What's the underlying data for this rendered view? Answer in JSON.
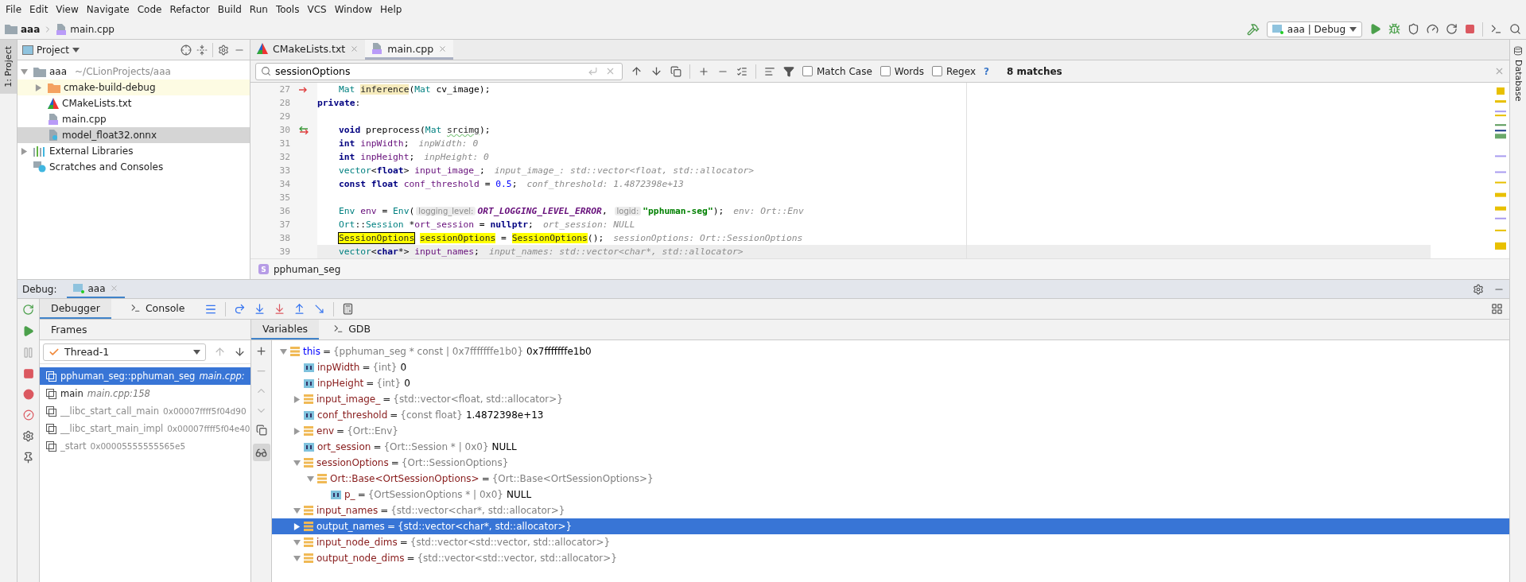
{
  "menu": [
    "File",
    "Edit",
    "View",
    "Navigate",
    "Code",
    "Refactor",
    "Build",
    "Run",
    "Tools",
    "VCS",
    "Window",
    "Help"
  ],
  "breadcrumb": [
    {
      "label": "aaa",
      "kind": "folder"
    },
    {
      "label": "main.cpp",
      "kind": "cpp"
    }
  ],
  "run_config": "aaa | Debug",
  "left_stripe": [
    {
      "label": "1: Project",
      "selected": true
    }
  ],
  "right_stripe": [
    {
      "label": "Database"
    }
  ],
  "project_panel": {
    "title": "Project",
    "tree": [
      {
        "label": "aaa",
        "path": "~/CLionProjects/aaa",
        "kind": "folder",
        "expanded": true,
        "selected": false,
        "highlighted": false,
        "children": [
          {
            "label": "cmake-build-debug",
            "kind": "build_folder",
            "expanded": false,
            "selected": false,
            "highlighted": true
          },
          {
            "label": "CMakeLists.txt",
            "kind": "cmake",
            "selected": false,
            "highlighted": false
          },
          {
            "label": "main.cpp",
            "kind": "cpp",
            "selected": false,
            "highlighted": false
          },
          {
            "label": "model_float32.onnx",
            "kind": "unknown",
            "selected": true,
            "highlighted": false
          }
        ]
      },
      {
        "label": "External Libraries",
        "kind": "libraries",
        "expanded": false,
        "selected": false,
        "highlighted": false
      },
      {
        "label": "Scratches and Consoles",
        "kind": "scratches",
        "selected": false,
        "highlighted": false
      }
    ]
  },
  "editor": {
    "tabs": [
      {
        "label": "CMakeLists.txt",
        "kind": "cmake",
        "selected": false
      },
      {
        "label": "main.cpp",
        "kind": "cpp",
        "selected": true
      }
    ],
    "find": {
      "value": "sessionOptions",
      "options": [
        {
          "label": "Match Case",
          "checked": false
        },
        {
          "label": "Words",
          "checked": false
        },
        {
          "label": "Regex",
          "checked": false
        }
      ],
      "help": "?",
      "matches": "8 matches"
    },
    "lines": [
      {
        "number": "27",
        "gutter": {
          "kind": "override"
        },
        "current": false,
        "indented": true,
        "tokens": [
          {
            "text": "Mat ",
            "kind": "type"
          },
          {
            "text": "inference",
            "kind": "ref"
          },
          {
            "text": "(",
            "kind": "plain"
          },
          {
            "text": "Mat",
            "kind": "type"
          },
          {
            "text": " cv_image);",
            "kind": "plain"
          }
        ]
      },
      {
        "number": "28",
        "current": false,
        "indented": false,
        "tokens": [
          {
            "text": "private",
            "kind": "kw"
          },
          {
            "text": ":",
            "kind": "plain"
          }
        ]
      },
      {
        "number": "29",
        "current": false
      },
      {
        "number": "30",
        "gutter": {
          "kind": "implements"
        },
        "current": false,
        "indented": true,
        "tokens": [
          {
            "text": "void",
            "kind": "kw"
          },
          {
            "text": " preprocess(",
            "kind": "plain"
          },
          {
            "text": "Mat ",
            "kind": "type"
          },
          {
            "text": "srcimg",
            "kind": "typo"
          },
          {
            "text": ");",
            "kind": "plain"
          }
        ]
      },
      {
        "number": "31",
        "current": false,
        "indented": true,
        "tokens": [
          {
            "text": "int ",
            "kind": "kw"
          },
          {
            "text": "inpWidth",
            "kind": "field"
          },
          {
            "text": ";",
            "kind": "plain"
          },
          {
            "text": "inpWidth: 0",
            "kind": "inlay"
          }
        ]
      },
      {
        "number": "32",
        "current": false,
        "indented": true,
        "tokens": [
          {
            "text": "int ",
            "kind": "kw"
          },
          {
            "text": "inpHeight",
            "kind": "field"
          },
          {
            "text": ";",
            "kind": "plain"
          },
          {
            "text": "inpHeight: 0",
            "kind": "inlay"
          }
        ]
      },
      {
        "number": "33",
        "current": false,
        "indented": true,
        "tokens": [
          {
            "text": "vector",
            "kind": "type"
          },
          {
            "text": "<",
            "kind": "plain"
          },
          {
            "text": "float",
            "kind": "kw"
          },
          {
            "text": "> ",
            "kind": "plain"
          },
          {
            "text": "input_image_",
            "kind": "field"
          },
          {
            "text": ";",
            "kind": "plain"
          },
          {
            "text": "input_image_: std::vector<float, std::allocator>",
            "kind": "inlay"
          }
        ]
      },
      {
        "number": "34",
        "current": false,
        "indented": true,
        "tokens": [
          {
            "text": "const ",
            "kind": "kw"
          },
          {
            "text": "float ",
            "kind": "kw"
          },
          {
            "text": "conf_threshold",
            "kind": "field"
          },
          {
            "text": " = ",
            "kind": "plain"
          },
          {
            "text": "0.5",
            "kind": "num"
          },
          {
            "text": ";",
            "kind": "plain"
          },
          {
            "text": "conf_threshold: 1.4872398e+13",
            "kind": "inlay"
          }
        ]
      },
      {
        "number": "35",
        "current": false
      },
      {
        "number": "36",
        "current": false,
        "indented": true,
        "tokens": [
          {
            "text": "Env ",
            "kind": "type"
          },
          {
            "text": "env",
            "kind": "field"
          },
          {
            "text": " = ",
            "kind": "plain"
          },
          {
            "text": "Env",
            "kind": "type"
          },
          {
            "text": "(",
            "kind": "plain"
          },
          {
            "text": "logging_level:",
            "kind": "hint"
          },
          {
            "text": "ORT_LOGGING_LEVEL_ERROR",
            "kind": "enum"
          },
          {
            "text": ", ",
            "kind": "plain"
          },
          {
            "text": "logid:",
            "kind": "hint"
          },
          {
            "text": "\"pphuman-seg\"",
            "kind": "str"
          },
          {
            "text": ");",
            "kind": "plain"
          },
          {
            "text": "env: Ort::Env",
            "kind": "inlay"
          }
        ]
      },
      {
        "number": "37",
        "current": false,
        "indented": true,
        "tokens": [
          {
            "text": "Ort",
            "kind": "type"
          },
          {
            "text": "::",
            "kind": "plain"
          },
          {
            "text": "Session",
            "kind": "type"
          },
          {
            "text": " *",
            "kind": "plain"
          },
          {
            "text": "ort_session",
            "kind": "field"
          },
          {
            "text": " = ",
            "kind": "plain"
          },
          {
            "text": "nullptr",
            "kind": "kw"
          },
          {
            "text": ";",
            "kind": "plain"
          },
          {
            "text": "ort_session: NULL",
            "kind": "inlay"
          }
        ]
      },
      {
        "number": "38",
        "current": false,
        "indented": true,
        "tokens": [
          {
            "text": "SessionOptions",
            "kind": "match_current"
          },
          {
            "text": "sessionOptions",
            "kind": "match"
          },
          {
            "text": " = ",
            "kind": "plain"
          },
          {
            "text": "SessionOptions",
            "kind": "match"
          },
          {
            "text": "();",
            "kind": "plain"
          },
          {
            "text": "sessionOptions: Ort::SessionOptions",
            "kind": "inlay"
          }
        ]
      },
      {
        "number": "39",
        "current": true,
        "indented": true,
        "tokens": [
          {
            "text": "vector",
            "kind": "type"
          },
          {
            "text": "<",
            "kind": "plain"
          },
          {
            "text": "char",
            "kind": "kw"
          },
          {
            "text": "*> ",
            "kind": "plain"
          },
          {
            "text": "input_names",
            "kind": "field"
          },
          {
            "text": ";",
            "kind": "plain"
          },
          {
            "text": "input_names: std::vector<char*, std::allocator>",
            "kind": "inlay"
          }
        ]
      }
    ],
    "context": {
      "icon_letter": "S",
      "label": "pphuman_seg"
    }
  },
  "debug": {
    "title": "Debug:",
    "session": "aaa",
    "tabs": [
      {
        "label": "Debugger",
        "selected": true
      },
      {
        "label": "Console",
        "selected": false
      }
    ],
    "frames": {
      "title": "Frames",
      "thread": "Thread-1",
      "items": [
        {
          "name": "pphuman_seg::pphuman_seg",
          "location": "main.cpp:",
          "selected": true,
          "dimmed": false
        },
        {
          "name": "main",
          "location": "main.cpp:158",
          "selected": false,
          "dimmed": false
        },
        {
          "name": "__libc_start_call_main",
          "location": "0x00007ffff5f04d90",
          "selected": false,
          "dimmed": true
        },
        {
          "name": "__libc_start_main_impl",
          "location": "0x00007ffff5f04e40",
          "selected": false,
          "dimmed": true
        },
        {
          "name": "_start",
          "location": "0x00005555555565e5",
          "selected": false,
          "dimmed": true
        }
      ]
    },
    "variable_tabs": [
      {
        "label": "Variables",
        "selected": true
      },
      {
        "label": "GDB",
        "selected": false
      }
    ],
    "variables": [
      {
        "name": "this",
        "eq": "=",
        "kind": "this",
        "expanded": true,
        "selected": false,
        "type": "{pphuman_seg * const | 0x7fffffffe1b0}",
        "value": "0x7fffffffe1b0",
        "children": [
          {
            "name": "inpWidth",
            "eq": "=",
            "kind": "primitive",
            "selected": false,
            "type": "{int}",
            "value": "0"
          },
          {
            "name": "inpHeight",
            "eq": "=",
            "kind": "primitive",
            "selected": false,
            "type": "{int}",
            "value": "0"
          },
          {
            "name": "input_image_",
            "eq": "=",
            "kind": "object",
            "expanded": false,
            "selected": false,
            "type": "{std::vector<float, std::allocator>}"
          },
          {
            "name": "conf_threshold",
            "eq": "=",
            "kind": "primitive",
            "selected": false,
            "type": "{const float}",
            "value": "1.4872398e+13"
          },
          {
            "name": "env",
            "eq": "=",
            "kind": "object",
            "expanded": false,
            "selected": false,
            "type": "{Ort::Env}"
          },
          {
            "name": "ort_session",
            "eq": "=",
            "kind": "primitive",
            "selected": false,
            "type": "{Ort::Session * | 0x0}",
            "value": "NULL"
          },
          {
            "name": "sessionOptions",
            "eq": "=",
            "kind": "object",
            "expanded": true,
            "selected": false,
            "type": "{Ort::SessionOptions}",
            "children": [
              {
                "name": "Ort::Base<OrtSessionOptions>",
                "eq": "=",
                "kind": "object",
                "expanded": true,
                "selected": false,
                "type": "{Ort::Base<OrtSessionOptions>}",
                "children": [
                  {
                    "name": "p_",
                    "eq": "=",
                    "kind": "primitive",
                    "selected": false,
                    "type": "{OrtSessionOptions * | 0x0}",
                    "value": "NULL"
                  }
                ]
              }
            ]
          },
          {
            "name": "input_names",
            "eq": "=",
            "kind": "object",
            "expanded": true,
            "selected": false,
            "type": "{std::vector<char*, std::allocator>}"
          },
          {
            "name": "output_names",
            "eq": "=",
            "kind": "object",
            "expanded": false,
            "selected": true,
            "type": "{std::vector<char*, std::allocator>}"
          },
          {
            "name": "input_node_dims",
            "eq": "=",
            "kind": "object",
            "expanded": true,
            "selected": false,
            "type": "{std::vector<std::vector, std::allocator>}"
          },
          {
            "name": "output_node_dims",
            "eq": "=",
            "kind": "object",
            "expanded": true,
            "selected": false,
            "type": "{std::vector<std::vector, std::allocator>}"
          }
        ]
      }
    ]
  }
}
